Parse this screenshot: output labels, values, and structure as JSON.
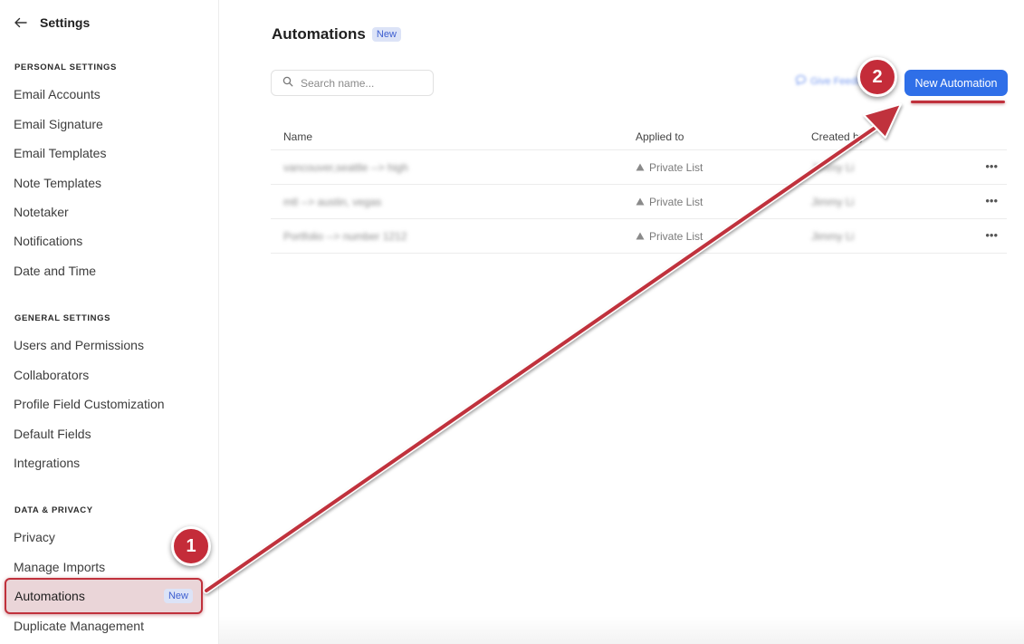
{
  "sidebar": {
    "title": "Settings",
    "sections": [
      {
        "heading": "PERSONAL SETTINGS",
        "items": [
          "Email Accounts",
          "Email Signature",
          "Email Templates",
          "Note Templates",
          "Notetaker",
          "Notifications",
          "Date and Time"
        ]
      },
      {
        "heading": "GENERAL SETTINGS",
        "items": [
          "Users and Permissions",
          "Collaborators",
          "Profile Field Customization",
          "Default Fields",
          "Integrations"
        ]
      },
      {
        "heading": "DATA & PRIVACY",
        "items": [
          "Privacy",
          "Manage Imports",
          "Automations",
          "Duplicate Management"
        ]
      }
    ],
    "active_item": {
      "label": "Automations",
      "badge": "New"
    }
  },
  "main": {
    "title": "Automations",
    "title_badge": "New",
    "search_placeholder": "Search name...",
    "feedback_label": "Give Feedback",
    "new_button_label": "New Automation",
    "columns": [
      "Name",
      "Applied to",
      "Created by"
    ],
    "rows": [
      {
        "name": "vancouver,seattle --> high",
        "applied_to": "Private List",
        "created_by": "Jimmy Li"
      },
      {
        "name": "mtl --> austin, vegas",
        "applied_to": "Private List",
        "created_by": "Jimmy Li"
      },
      {
        "name": "Portfolio --> number 1212",
        "applied_to": "Private List",
        "created_by": "Jimmy Li"
      }
    ],
    "row_menu_icon": "more-horizontal-icon"
  },
  "annotations": {
    "step_1": "1",
    "step_2": "2",
    "arrow_color": "#c0313c"
  }
}
